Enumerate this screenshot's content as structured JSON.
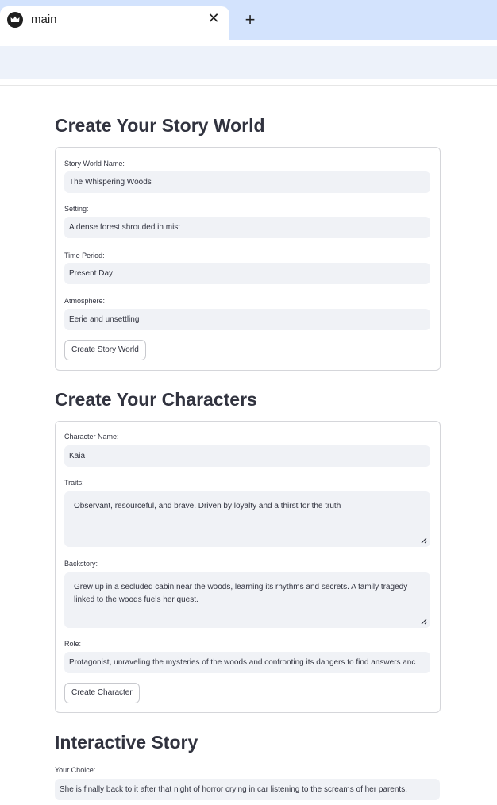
{
  "browser": {
    "tab_title": "main",
    "close_glyph": "✕",
    "new_tab_glyph": "+",
    "favicon_icon": "crown-icon"
  },
  "story_world": {
    "heading": "Create Your Story World",
    "name_label": "Story World Name:",
    "name_value": "The Whispering Woods",
    "setting_label": "Setting:",
    "setting_value": "A dense forest shrouded in mist",
    "period_label": "Time Period:",
    "period_value": "Present Day",
    "atmosphere_label": "Atmosphere:",
    "atmosphere_value": "Eerie and unsettling",
    "button": "Create Story World"
  },
  "characters": {
    "heading": "Create Your Characters",
    "name_label": "Character Name:",
    "name_value": "Kaia",
    "traits_label": "Traits:",
    "traits_value": "Observant, resourceful, and brave. Driven by loyalty and a thirst for the truth",
    "backstory_label": "Backstory:",
    "backstory_value": "Grew up in a secluded cabin near the woods, learning its rhythms and secrets. A family tragedy linked to the woods fuels her quest.",
    "role_label": "Role:",
    "role_value": "Protagonist, unraveling the mysteries of the woods and confronting its dangers to find answers anc",
    "button": "Create Character"
  },
  "interactive": {
    "heading": "Interactive Story",
    "choice_label": "Your Choice:",
    "choice_value": "She is finally back to it after that night of horror crying in car listening to the screams of her parents."
  }
}
